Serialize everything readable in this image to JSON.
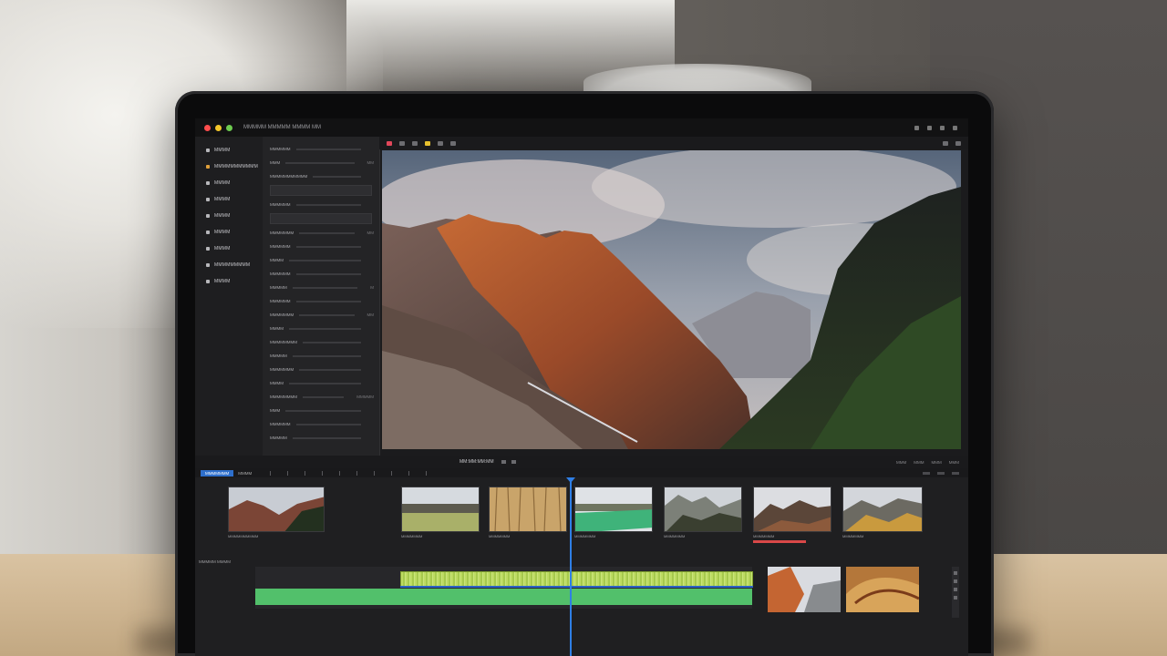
{
  "app": {
    "title": "MMMMM MMMMM MMMM MM",
    "window_controls": [
      "close-icon",
      "minimize-icon",
      "zoom-icon"
    ]
  },
  "sidebar": {
    "items": [
      {
        "label": "MMMM",
        "icon": "library-icon"
      },
      {
        "label": "MMMMMMMMMMM",
        "icon": "collection-icon"
      },
      {
        "label": "MMMM",
        "icon": "folder-icon"
      },
      {
        "label": "MMMM",
        "icon": "folder-icon"
      },
      {
        "label": "MMMM",
        "icon": "folder-icon"
      },
      {
        "label": "MMMM",
        "icon": "folder-icon"
      },
      {
        "label": "MMMM",
        "icon": "folder-icon"
      },
      {
        "label": "MMMMMMMMM",
        "icon": "folder-icon"
      },
      {
        "label": "MMMM",
        "icon": "folder-icon"
      }
    ]
  },
  "inspector": {
    "rows": [
      {
        "key": "MMMMMM",
        "value": ""
      },
      {
        "key": "MMM",
        "value": "MM"
      },
      {
        "key": "MMMMMMMMMMM",
        "value": ""
      },
      {
        "key": "MMMMMM",
        "value": ""
      },
      {
        "key": "MMMMMMM",
        "value": "MM"
      },
      {
        "key": "MMMMMM",
        "value": ""
      },
      {
        "key": "MMMM",
        "value": ""
      },
      {
        "key": "MMMMMM",
        "value": ""
      },
      {
        "key": "MMMMM",
        "value": "M"
      },
      {
        "key": "MMMMMM",
        "value": ""
      },
      {
        "key": "MMMMMMM",
        "value": "MM"
      },
      {
        "key": "MMMM",
        "value": ""
      },
      {
        "key": "MMMMMMMM",
        "value": ""
      },
      {
        "key": "MMMMM",
        "value": ""
      },
      {
        "key": "MMMMMMM",
        "value": ""
      },
      {
        "key": "MMMM",
        "value": ""
      },
      {
        "key": "MMMMMMMM",
        "value": "MMMMM"
      },
      {
        "key": "MMM",
        "value": ""
      },
      {
        "key": "MMMMMM",
        "value": ""
      },
      {
        "key": "MMMMM",
        "value": ""
      }
    ]
  },
  "transport": {
    "timecode": "MM:MM:MM:MM",
    "right_items": [
      "MMM",
      "MMM",
      "MMM",
      "MMM"
    ]
  },
  "timeline": {
    "active_tab": "MMMMMMM",
    "second_tab": "MMMM",
    "track_label": "MMMMM MMMM",
    "clips": [
      {
        "caption": "MMMMMMMMMM",
        "scene": "mountain-warm"
      },
      {
        "caption": "MMMMMMM",
        "scene": "valley-green"
      },
      {
        "caption": "MMMMMMM",
        "scene": "wheat-field"
      },
      {
        "caption": "MMMMMMM",
        "scene": "green-lake"
      },
      {
        "caption": "MMMMMMM",
        "scene": "mountain-mist"
      },
      {
        "caption": "MMMMMMM",
        "scene": "mountain-sunset"
      },
      {
        "caption": "MMMMMMM",
        "scene": "mountain-autumn"
      }
    ]
  }
}
